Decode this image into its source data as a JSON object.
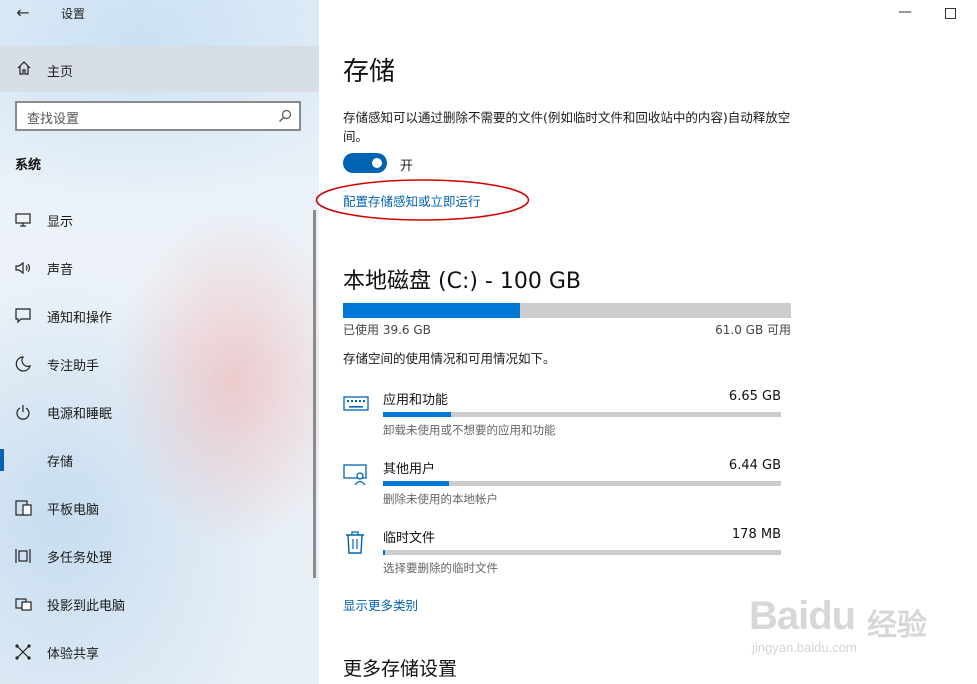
{
  "window": {
    "title": "设置"
  },
  "sidebar": {
    "home_label": "主页",
    "search_placeholder": "查找设置",
    "section_title": "系统",
    "items": [
      {
        "label": "显示",
        "icon": "display-icon"
      },
      {
        "label": "声音",
        "icon": "speaker-icon"
      },
      {
        "label": "通知和操作",
        "icon": "notification-icon"
      },
      {
        "label": "专注助手",
        "icon": "moon-icon"
      },
      {
        "label": "电源和睡眠",
        "icon": "power-icon"
      },
      {
        "label": "存储",
        "icon": "storage-icon",
        "active": true
      },
      {
        "label": "平板电脑",
        "icon": "tablet-icon"
      },
      {
        "label": "多任务处理",
        "icon": "multitask-icon"
      },
      {
        "label": "投影到此电脑",
        "icon": "project-icon"
      },
      {
        "label": "体验共享",
        "icon": "share-icon"
      }
    ]
  },
  "main": {
    "title": "存储",
    "storage_sense_desc": "存储感知可以通过删除不需要的文件(例如临时文件和回收站中的内容)自动释放空间。",
    "toggle": {
      "state_label": "开",
      "on": true
    },
    "config_link": "配置存储感知或立即运行",
    "disk": {
      "title": "本地磁盘 (C:) - 100 GB",
      "used_label": "已使用 39.6 GB",
      "free_label": "61.0 GB 可用",
      "used_fraction": 0.396
    },
    "usage_hint": "存储空间的使用情况和可用情况如下。",
    "categories": [
      {
        "name": "应用和功能",
        "size": "6.65 GB",
        "sub": "卸载未使用或不想要的应用和功能",
        "fraction": 0.17,
        "icon": "keyboard-icon"
      },
      {
        "name": "其他用户",
        "size": "6.44 GB",
        "sub": "删除未使用的本地帐户",
        "fraction": 0.165,
        "icon": "user-account-icon"
      },
      {
        "name": "临时文件",
        "size": "178 MB",
        "sub": "选择要删除的临时文件",
        "fraction": 0.005,
        "icon": "trash-icon"
      }
    ],
    "more_categories_link": "显示更多类别",
    "more_settings_title": "更多存储设置"
  },
  "watermark": {
    "brand": "Bai",
    "brand2": "du",
    "cn": "经验",
    "url": "jingyan.baidu.com"
  },
  "colors": {
    "accent": "#0063b1",
    "bar": "#0078d7",
    "track": "#cccccc",
    "annotation": "#d40000"
  }
}
